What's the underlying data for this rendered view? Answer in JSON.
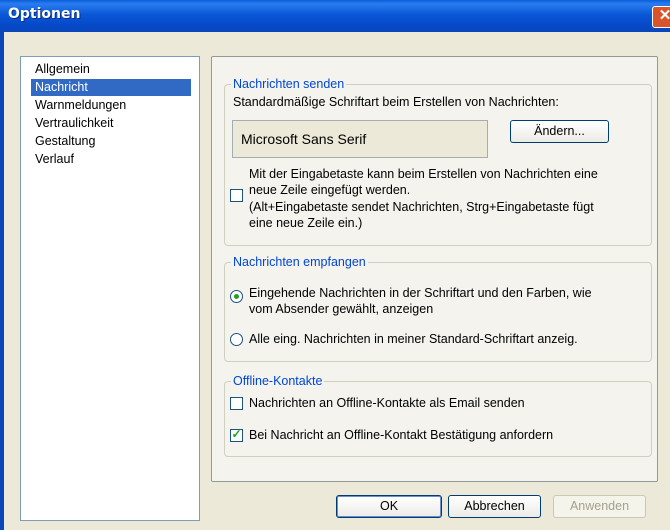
{
  "window": {
    "title": "Optionen",
    "close_glyph": "✕"
  },
  "nav": {
    "items": [
      "Allgemein",
      "Nachricht",
      "Warnmeldungen",
      "Vertraulichkeit",
      "Gestaltung",
      "Verlauf"
    ],
    "selected": "Nachricht"
  },
  "send": {
    "legend": "Nachrichten senden",
    "font_label": "Standardmäßige Schriftart beim Erstellen von Nachrichten:",
    "font_name": "Microsoft Sans Serif",
    "change_button": "Ändern...",
    "enter_line1": "Mit der Eingabetaste kann beim Erstellen von Nachrichten eine",
    "enter_line2": "neue Zeile eingefügt werden.",
    "enter_line3": "(Alt+Eingabetaste sendet Nachrichten, Strg+Eingabetaste fügt",
    "enter_line4": "eine neue Zeile ein.)",
    "enter_checked": false
  },
  "receive": {
    "legend": "Nachrichten empfangen",
    "opt1_line1": "Eingehende Nachrichten in der Schriftart und den Farben, wie",
    "opt1_line2": "vom Absender gewählt, anzeigen",
    "opt2": "Alle eing. Nachrichten in meiner Standard-Schriftart anzeig.",
    "selected": "opt1"
  },
  "offline": {
    "legend": "Offline-Kontakte",
    "email_label": "Nachrichten an Offline-Kontakte als Email senden",
    "email_checked": false,
    "confirm_label": "Bei Nachricht an Offline-Kontakt Bestätigung anfordern",
    "confirm_checked": true
  },
  "buttons": {
    "ok": "OK",
    "cancel": "Abbrechen",
    "apply": "Anwenden"
  },
  "colors": {
    "titlebar": "#0a58d6",
    "selection": "#316ac5",
    "legend": "#0046d5",
    "check": "#21a121"
  }
}
